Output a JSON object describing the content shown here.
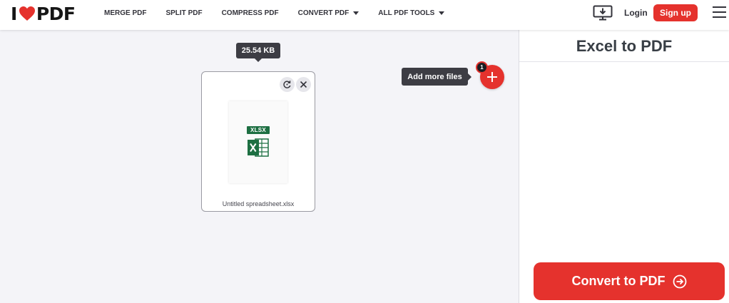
{
  "header": {
    "logo": {
      "left_text": "I",
      "right_text": "PDF",
      "heart_color": "#e5322d"
    },
    "nav": [
      {
        "label": "MERGE PDF",
        "dropdown": false
      },
      {
        "label": "SPLIT PDF",
        "dropdown": false
      },
      {
        "label": "COMPRESS PDF",
        "dropdown": false
      },
      {
        "label": "CONVERT PDF",
        "dropdown": true
      },
      {
        "label": "ALL PDF TOOLS",
        "dropdown": true
      }
    ],
    "desktop_icon": "desktop-download-icon",
    "login_label": "Login",
    "signup_label": "Sign up",
    "menu_icon": "hamburger-menu-icon"
  },
  "workspace": {
    "file_size": "25.54 KB",
    "file": {
      "type_label": "XLSX",
      "name": "Untitled spreadsheet.xlsx",
      "icon": "excel-file-icon",
      "rotate_icon": "rotate-icon",
      "remove_icon": "close-icon"
    },
    "add_more_tooltip": "Add more files",
    "file_count": "1",
    "add_icon": "plus-icon"
  },
  "sidebar": {
    "title": "Excel to PDF",
    "convert_label": "Convert to PDF",
    "convert_icon": "arrow-right-circle-icon"
  },
  "colors": {
    "brand_red": "#e5322d",
    "excel_green": "#1d6f42",
    "tooltip_dark": "#3d3d44",
    "workspace_bg": "#f4f4f8"
  }
}
